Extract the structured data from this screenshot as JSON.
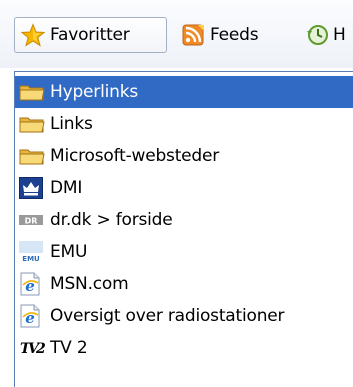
{
  "toolbar": {
    "tabs": [
      {
        "label": "Favoritter",
        "icon": "star-icon",
        "active": true
      },
      {
        "label": "Feeds",
        "icon": "rss-feed-icon",
        "active": false
      },
      {
        "label": "Historik",
        "icon": "history-clock-icon",
        "active": false,
        "visible_text": "H"
      }
    ]
  },
  "favorites": {
    "items": [
      {
        "label": "Hyperlinks",
        "icon": "folder-icon",
        "selected": true
      },
      {
        "label": "Links",
        "icon": "folder-icon",
        "selected": false
      },
      {
        "label": "Microsoft-websteder",
        "icon": "folder-icon",
        "selected": false
      },
      {
        "label": "DMI",
        "icon": "dmi-crown-icon",
        "selected": false
      },
      {
        "label": "dr.dk > forside",
        "icon": "dr-logo-icon",
        "selected": false
      },
      {
        "label": "EMU",
        "icon": "emu-logo-icon",
        "selected": false
      },
      {
        "label": "MSN.com",
        "icon": "ie-page-icon",
        "selected": false
      },
      {
        "label": "Oversigt over radiostationer",
        "icon": "ie-page-icon",
        "selected": false
      },
      {
        "label": "TV 2",
        "icon": "tv2-logo-icon",
        "selected": false
      }
    ]
  },
  "colors": {
    "selection": "#316ac5",
    "panel_border": "#5a7fb7",
    "folder": "#f2c94c"
  }
}
